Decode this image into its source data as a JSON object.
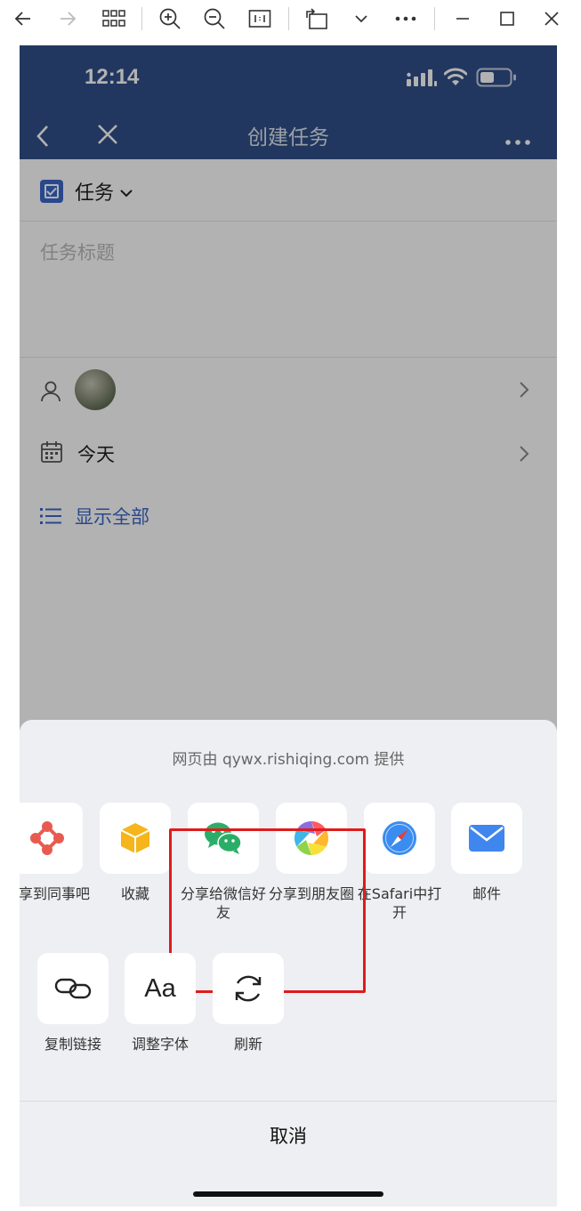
{
  "status_bar": {
    "time": "12:14"
  },
  "navbar": {
    "title": "创建任务"
  },
  "task": {
    "type_label": "任务",
    "title_placeholder": "任务标题",
    "date_label": "今天",
    "show_all_label": "显示全部"
  },
  "share_sheet": {
    "provider": "网页由 qywx.rishiqing.com 提供",
    "row1": [
      {
        "label": "分享到同事吧"
      },
      {
        "label": "收藏"
      },
      {
        "label": "分享给微信好友"
      },
      {
        "label": "分享到朋友圈"
      },
      {
        "label": "在Safari中打开"
      },
      {
        "label": "邮件"
      }
    ],
    "row2": [
      {
        "label": "复制链接"
      },
      {
        "label": "调整字体",
        "glyph": "Aa"
      },
      {
        "label": "刷新"
      }
    ],
    "cancel_label": "取消"
  },
  "colors": {
    "nav_blue": "#315089",
    "accent_blue": "#3b68c9",
    "highlight_red": "#e01b1b",
    "wechat_green": "#2aae67"
  }
}
